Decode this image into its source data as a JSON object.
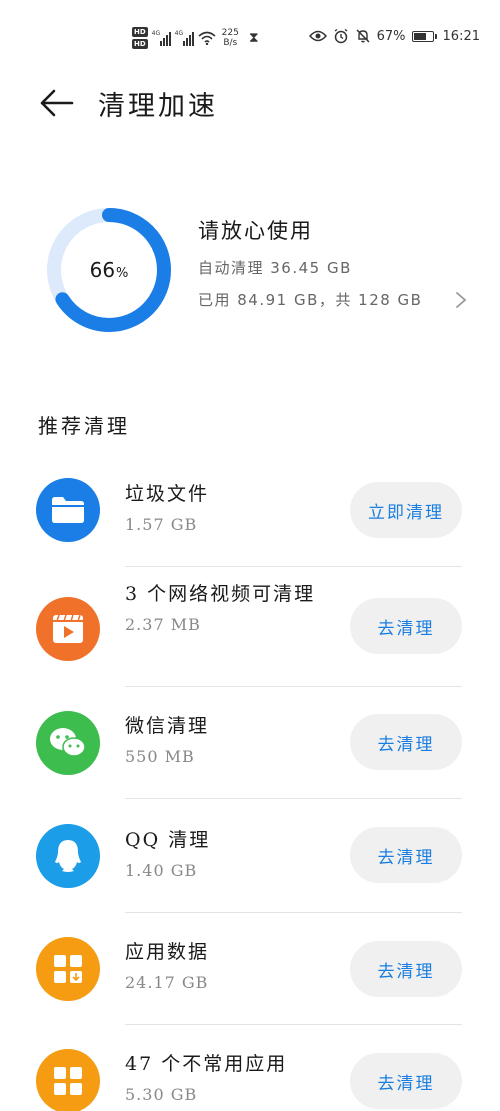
{
  "status_bar": {
    "hd_1": "HD",
    "hd_2": "HD",
    "sim_1": "4G",
    "sim_2": "4G",
    "net_speed_value": "225",
    "net_speed_unit": "B/s",
    "battery": "67%",
    "battery_level": 0.67,
    "time": "16:21"
  },
  "header": {
    "title": "清理加速"
  },
  "storage": {
    "used_percent": 66,
    "percent_number": "66",
    "percent_sign": "%",
    "status": "请放心使用",
    "auto_clean": "自动清理 36.45 GB",
    "usage": "已用 84.91 GB，共 128 GB"
  },
  "section": {
    "title": "推荐清理"
  },
  "items": [
    {
      "name": "垃圾文件",
      "size": "1.57 GB",
      "button": "立即清理",
      "icon": "folder-icon",
      "color": "#1a7ee6"
    },
    {
      "name": "3 个网络视频可清理",
      "size": "2.37 MB",
      "button": "去清理",
      "icon": "video-icon",
      "color": "#f0722a"
    },
    {
      "name": "微信清理",
      "size": "550 MB",
      "button": "去清理",
      "icon": "wechat-icon",
      "color": "#3dbd4e"
    },
    {
      "name": "QQ 清理",
      "size": "1.40 GB",
      "button": "去清理",
      "icon": "qq-icon",
      "color": "#1b9de8"
    },
    {
      "name": "应用数据",
      "size": "24.17 GB",
      "button": "去清理",
      "icon": "app-data-icon",
      "color": "#f59c12"
    },
    {
      "name": "47 个不常用应用",
      "size": "5.30 GB",
      "button": "去清理",
      "icon": "apps-icon",
      "color": "#f59c12"
    }
  ]
}
